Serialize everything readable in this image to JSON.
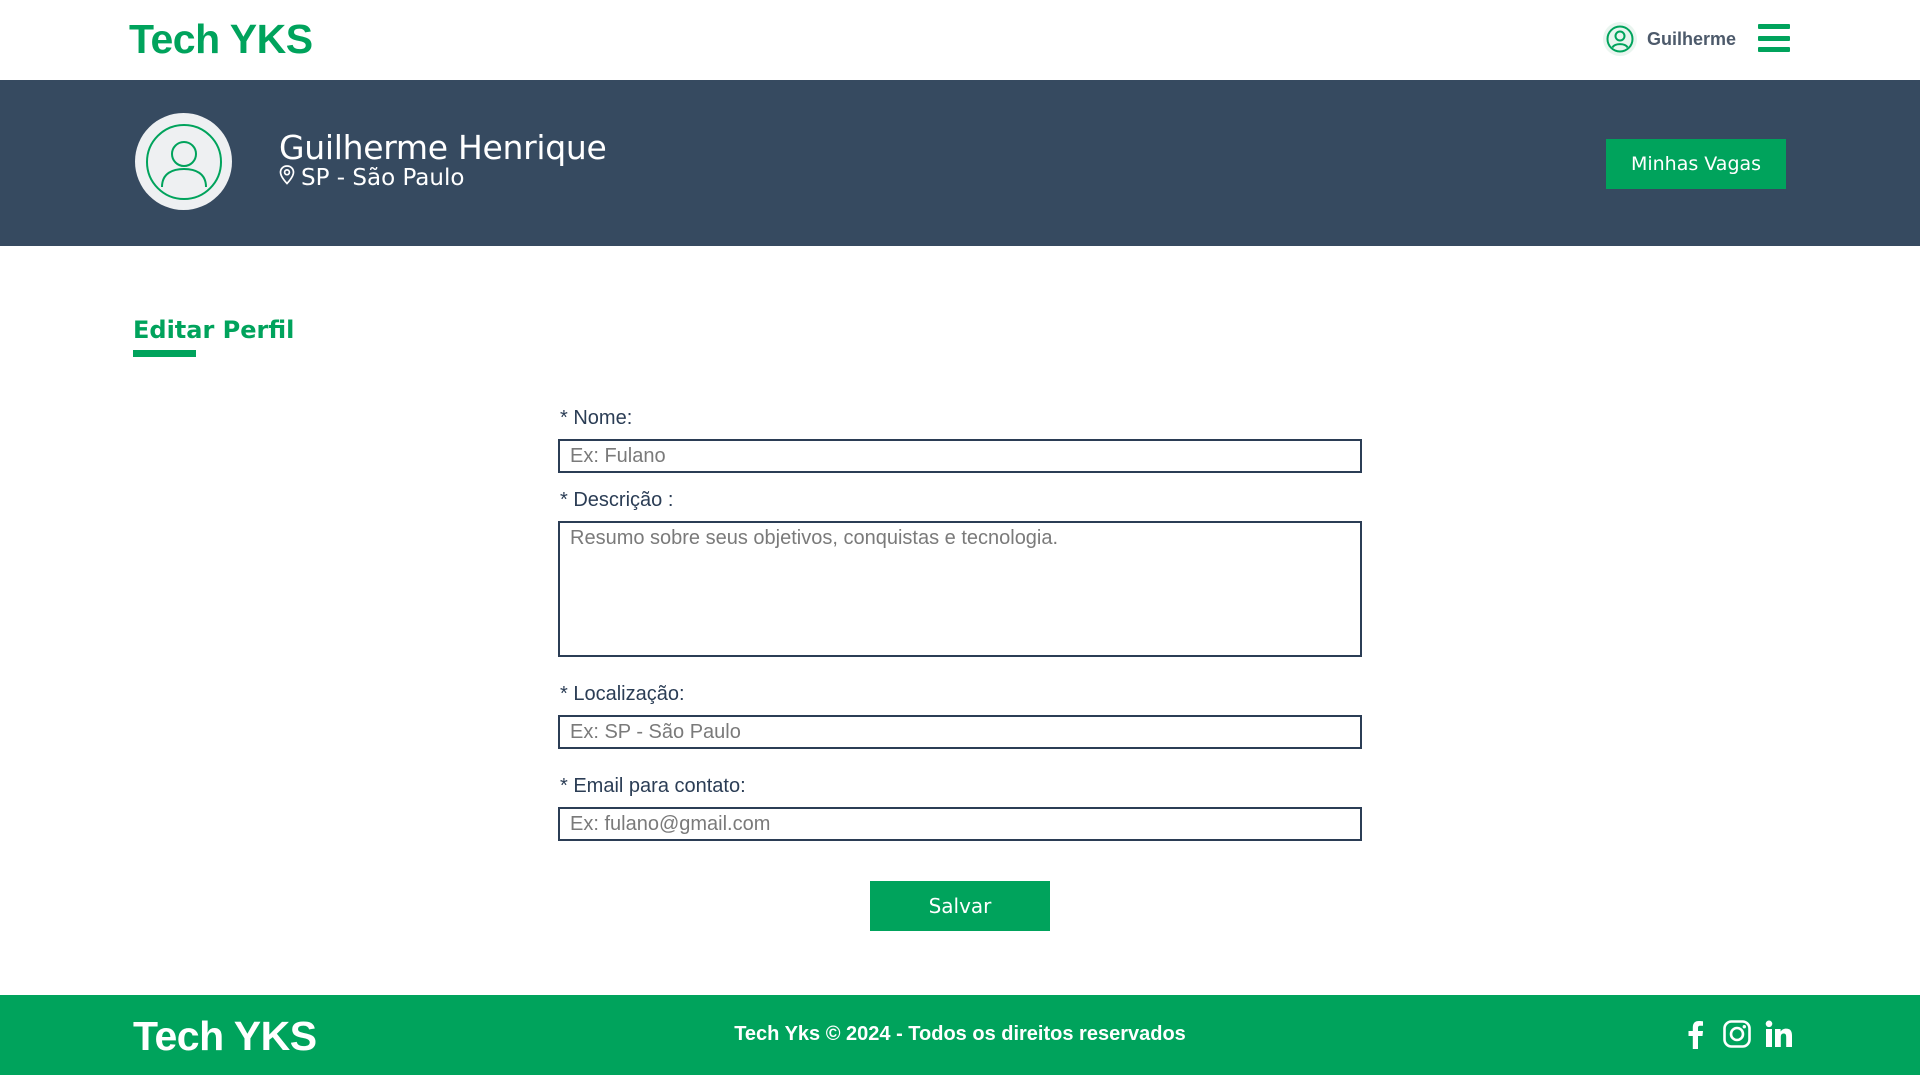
{
  "nav": {
    "brand": "Tech YKS",
    "user_name": "Guilherme",
    "user_icon": "user-circle-icon",
    "menu_icon": "hamburger-menu-icon"
  },
  "profile": {
    "name": "Guilherme Henrique",
    "location": "SP - São Paulo",
    "location_icon": "map-pin-icon",
    "avatar_icon": "user-avatar-icon",
    "jobs_button": "Minhas Vagas"
  },
  "section": {
    "title": "Editar Perfil"
  },
  "form": {
    "name_label": "* Nome:",
    "name_placeholder": "Ex: Fulano",
    "description_label": "* Descrição :",
    "description_placeholder": "Resumo sobre seus objetivos, conquistas e tecnologia.",
    "location_label": "* Localização:",
    "location_placeholder": "Ex: SP - São Paulo",
    "email_label": "* Email para contato:",
    "email_placeholder": "Ex: fulano@gmail.com",
    "save_button": "Salvar"
  },
  "footer": {
    "brand": "Tech YKS",
    "copyright": "Tech Yks © 2024 - Todos os direitos reservados",
    "social_icons": [
      "facebook-icon",
      "instagram-icon",
      "linkedin-icon"
    ]
  },
  "colors": {
    "brand_green": "#00a35c",
    "banner_navy": "#364a60",
    "text_navy": "#2b3d55"
  }
}
